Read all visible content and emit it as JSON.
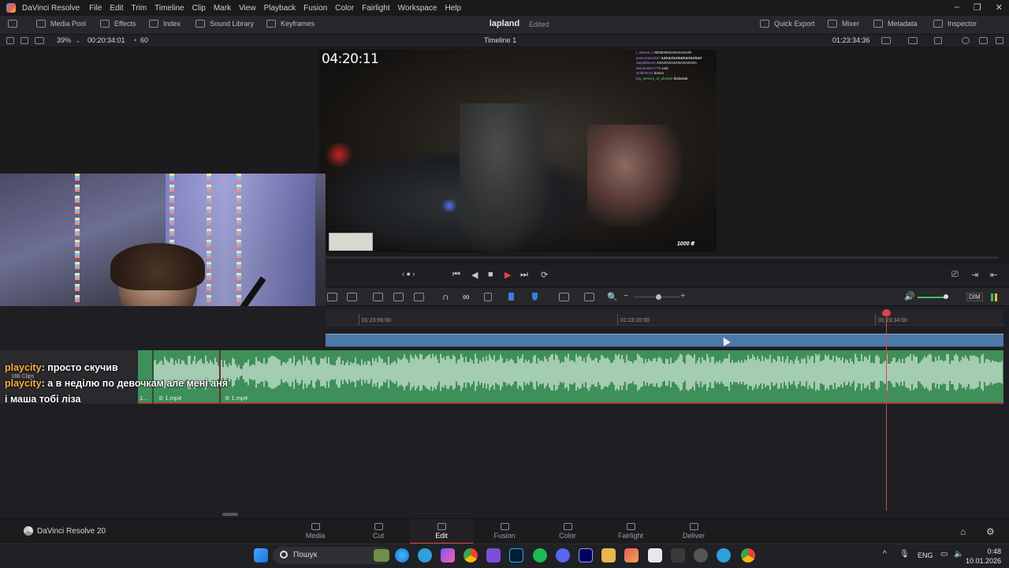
{
  "menubar": {
    "app_name": "DaVinci Resolve",
    "items": [
      "File",
      "Edit",
      "Trim",
      "Timeline",
      "Clip",
      "Mark",
      "View",
      "Playback",
      "Fusion",
      "Color",
      "Fairlight",
      "Workspace",
      "Help"
    ]
  },
  "toolbar": {
    "media_pool": "Media Pool",
    "effects": "Effects",
    "index": "Index",
    "sound_library": "Sound Library",
    "keyframes": "Keyframes",
    "project_name": "lapland",
    "project_status": "Edited",
    "quick_export": "Quick Export",
    "mixer": "Mixer",
    "metadata": "Metadata",
    "inspector": "Inspector"
  },
  "viewer": {
    "zoom": "39%",
    "source_timecode": "00:20:34:01",
    "fps": "60",
    "timeline_name": "Timeline 1",
    "record_timecode": "01:23:34:36",
    "overlay_timer": "04:20:11",
    "overlay_badge": "1000 ₴",
    "overlay_chat": [
      {
        "user": "l_ukteral_s",
        "msg": "ХЕХЕХЕХАХАХАХАХ!!"
      },
      {
        "user": "pxecomas1957",
        "msg": "ШИШИШИШИШИШИШИ"
      },
      {
        "user": "Zatyablemm",
        "msg": "АХАХАХАХАХАХАХАХА"
      },
      {
        "user": "demonster7770",
        "msg": "Lolz"
      },
      {
        "user": "vinhlemcrs",
        "msg": "bonzo"
      },
      {
        "user": "too_service_of_ukraine",
        "msg": "bialostok"
      }
    ]
  },
  "timeline": {
    "ticks": [
      "01:23:06:00",
      "01:23:20:00",
      "01:23:34:00"
    ],
    "clip_count": "188 Clips",
    "clips": [
      "1...",
      "1.mp4",
      "1.mp4"
    ],
    "dim_label": "DIM"
  },
  "chat": [
    {
      "user": "playcity",
      "msg": "просто скучив"
    },
    {
      "user": "playcity",
      "msg": "а в неділю по девочкам але мені аня"
    },
    {
      "user": "",
      "msg": "і маша тобі ліза"
    }
  ],
  "pages": [
    {
      "label": "Media",
      "active": false
    },
    {
      "label": "Cut",
      "active": false
    },
    {
      "label": "Edit",
      "active": true
    },
    {
      "label": "Fusion",
      "active": false
    },
    {
      "label": "Color",
      "active": false
    },
    {
      "label": "Fairlight",
      "active": false
    },
    {
      "label": "Deliver",
      "active": false
    }
  ],
  "brand": "DaVinci Resolve 20",
  "taskbar": {
    "search_placeholder": "Пошук",
    "lang": "ENG",
    "time": "0:48",
    "date": "10.01.2026"
  },
  "colors": {
    "accent": "#d84848",
    "video_track": "#4d79a8",
    "audio_track": "#3f8f5a"
  }
}
